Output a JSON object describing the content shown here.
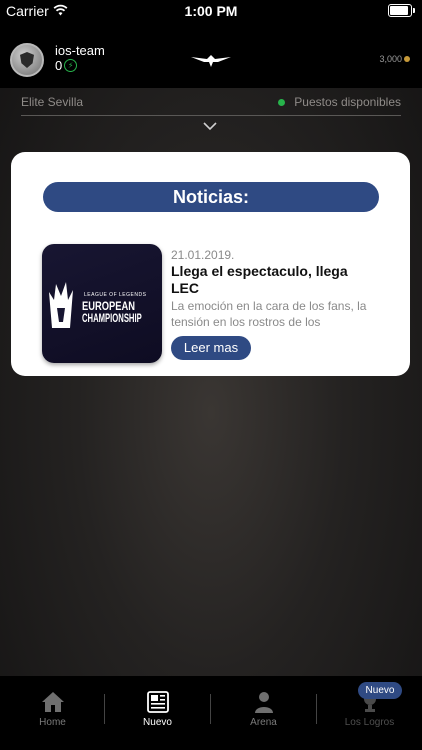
{
  "status_bar": {
    "carrier": "Carrier",
    "time": "1:00 PM"
  },
  "header": {
    "username": "ios-team",
    "points": "0",
    "coins": "3,000"
  },
  "location": {
    "name": "Elite Sevilla",
    "status": "Puestos disponibles"
  },
  "news": {
    "section_title": "Noticias:",
    "item": {
      "thumb_lol": "LEAGUE OF LEGENDS",
      "thumb_euro": "EUROPEAN",
      "thumb_champ": "CHAMPIONSHIP",
      "date": "21.01.2019.",
      "headline": "Llega el espectaculo, llega LEC",
      "summary": "La emoción en la cara de los fans, la tensión en los rostros de los",
      "button": "Leer mas"
    }
  },
  "tabbar": {
    "tabs": [
      {
        "label": "Home",
        "icon": "home-icon"
      },
      {
        "label": "Nuevo",
        "icon": "news-icon"
      },
      {
        "label": "Arena",
        "icon": "person-icon"
      },
      {
        "label": "Los Logros",
        "icon": "trophy-icon"
      }
    ],
    "badge": "Nuevo"
  },
  "colors": {
    "accent": "#2f4a83",
    "online": "#27b34b",
    "coin": "#c79a3a"
  }
}
